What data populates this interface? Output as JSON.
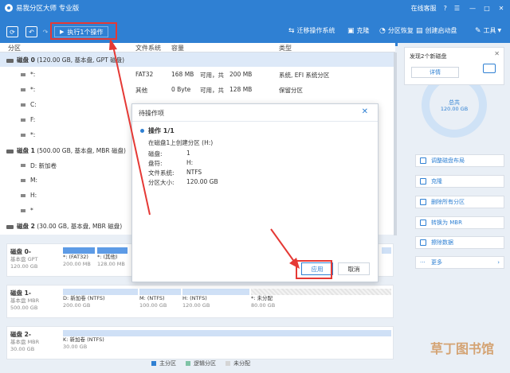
{
  "titlebar": {
    "app_title": "易我分区大师 专业版",
    "online_support": "在线客服",
    "icon_labels": [
      "?",
      "☰",
      "—",
      "□",
      "✕"
    ]
  },
  "toolbar": {
    "refresh_icon": "⟳",
    "undo_icon": "↶",
    "redo_icon": "↷",
    "execute_label": "执行1个操作",
    "migrate_os": "迁移操作系统",
    "clone": "克隆",
    "partition_recovery": "分区恢复",
    "create_boot_disk": "创建启动盘",
    "tools": "工具"
  },
  "columns": {
    "partition": "分区",
    "filesystem": "文件系统",
    "capacity": "容量",
    "type": "类型"
  },
  "disk_rows": [
    {
      "name": "磁盘 0",
      "info": "(120.00 GB, 基本盘, GPT 磁盘)"
    },
    {
      "name": "*:",
      "fs": "FAT32",
      "cap": "168 MB",
      "free": "可用，共",
      "total": "200 MB",
      "type": "系统, EFI 系统分区"
    },
    {
      "name": "*:",
      "fs": "其他",
      "cap": "0 Byte",
      "free": "可用，共",
      "total": "128 MB",
      "type": "保留分区"
    },
    {
      "name": "C:"
    },
    {
      "name": "F:"
    },
    {
      "name": "*:"
    },
    {
      "name": "磁盘 1",
      "info": "(500.00 GB, 基本盘, MBR 磁盘)"
    },
    {
      "name": "D: 新加卷"
    },
    {
      "name": "M:"
    },
    {
      "name": "H:"
    },
    {
      "name": "*"
    },
    {
      "name": "磁盘 2",
      "info": "(30.00 GB, 基本盘, MBR 磁盘)"
    }
  ],
  "diskmap": [
    {
      "name": "磁盘 0-",
      "sub1": "基本盘 GPT",
      "sub2": "120.00 GB",
      "segs": [
        {
          "t": "*: (FAT32)",
          "t2": "200.00 MB"
        },
        {
          "t": "*: (其他)",
          "t2": "128.00 MB"
        }
      ]
    },
    {
      "name": "磁盘 1-",
      "sub1": "基本盘 MBR",
      "sub2": "500.00 GB",
      "segs": [
        {
          "t": "D: 新加卷 (NTFS)",
          "t2": "200.00 GB"
        },
        {
          "t": "M: (NTFS)",
          "t2": "100.00 GB"
        },
        {
          "t": "H: (NTFS)",
          "t2": "120.00 GB"
        },
        {
          "t": "*: 未分配",
          "t2": "80.00 GB"
        }
      ]
    },
    {
      "name": "磁盘 2-",
      "sub1": "基本盘 MBR",
      "sub2": "30.00 GB",
      "segs": [
        {
          "t": "K: 新加卷 (NTFS)",
          "t2": "30.00 GB"
        }
      ]
    }
  ],
  "legend": {
    "primary": "主分区",
    "logical": "逻辑分区",
    "unallocated": "未分配"
  },
  "right_panel": {
    "new_disk_text": "发现2个新磁盘",
    "details": "详情",
    "donut_line1": "总共",
    "donut_line2": "120.00 GB",
    "actions": [
      "调整磁盘布局",
      "克隆",
      "删除所有分区",
      "转换为 MBR",
      "擦除数据",
      "更多"
    ]
  },
  "dialog": {
    "title": "待操作项",
    "close": "✕",
    "op_label": "操作 1/1",
    "description": "在磁盘1上创建分区 (H:)",
    "fields": [
      {
        "k": "磁盘:",
        "v": "1"
      },
      {
        "k": "盘符:",
        "v": "H:"
      },
      {
        "k": "文件系统:",
        "v": "NTFS"
      },
      {
        "k": "分区大小:",
        "v": "120.00 GB"
      }
    ],
    "apply": "应用",
    "cancel": "取消"
  },
  "watermark": "草丁图书馆",
  "colors": {
    "accent": "#2f80d3",
    "highlight": "#e53935"
  }
}
